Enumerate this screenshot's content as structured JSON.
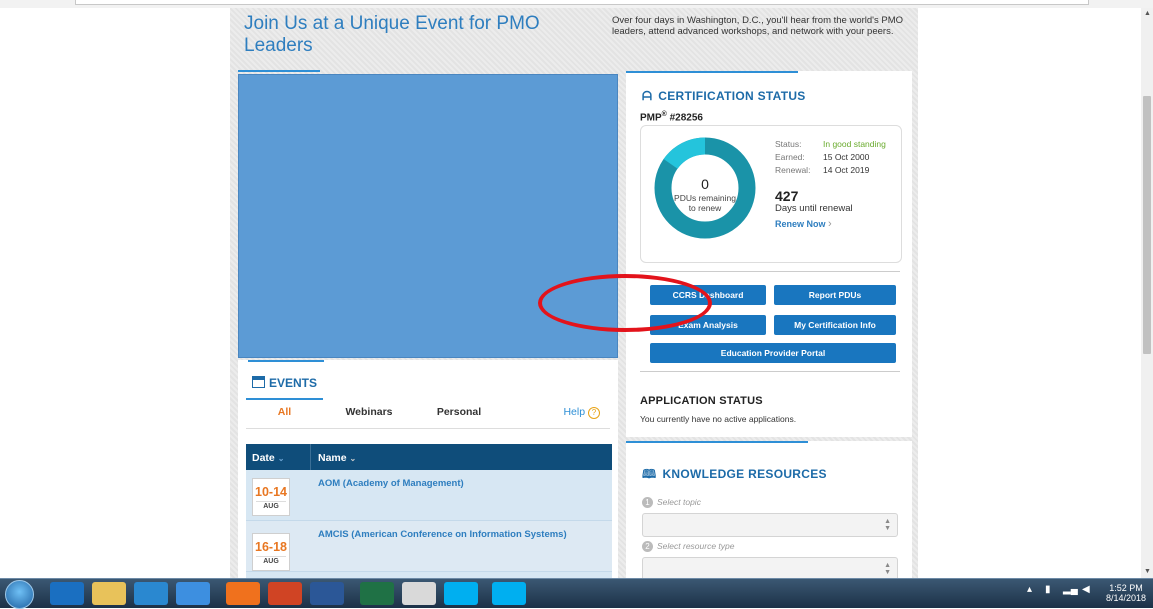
{
  "hero": {
    "title": "Join Us at a Unique Event for PMO Leaders",
    "description": "Over four days in Washington, D.C., you'll hear from the world's PMO leaders, attend advanced workshops, and network with your peers."
  },
  "events": {
    "heading": "EVENTS",
    "tabs": [
      "All",
      "Webinars",
      "Personal"
    ],
    "help_label": "Help",
    "table": {
      "headers": [
        "Date",
        "Name"
      ],
      "rows": [
        {
          "date": "10-14",
          "month": "AUG",
          "name": "AOM (Academy of Management)"
        },
        {
          "date": "16-18",
          "month": "AUG",
          "name": "AMCIS (American Conference on Information Systems)"
        }
      ]
    }
  },
  "certification": {
    "heading": "CERTIFICATION STATUS",
    "credential": "PMP",
    "credential_mark": "®",
    "credential_number": "#28256",
    "pdus_remaining": "0",
    "pdus_label": "PDUs remaining to renew",
    "status_label": "Status:",
    "status_value": "In good standing",
    "earned_label": "Earned:",
    "earned_value": "15 Oct 2000",
    "renewal_label": "Renewal:",
    "renewal_value": "14 Oct 2019",
    "days_count": "427",
    "days_label": "Days until renewal",
    "renew_link": "Renew Now",
    "buttons": {
      "ccrs": "CCRS Dashboard",
      "report": "Report PDUs",
      "exam": "Exam Analysis",
      "info": "My Certification Info",
      "portal": "Education Provider Portal"
    }
  },
  "application": {
    "heading": "APPLICATION STATUS",
    "text": "You currently have no active applications."
  },
  "knowledge": {
    "heading": "KNOWLEDGE RESOURCES",
    "step1": "Select topic",
    "step2": "Select resource type"
  },
  "taskbar": {
    "time": "1:52 PM",
    "date": "8/14/2018"
  },
  "colors": {
    "brand_blue": "#1976bf",
    "accent_orange": "#e87722",
    "good_green": "#6aab2e",
    "highlight_red": "#e3131b"
  }
}
